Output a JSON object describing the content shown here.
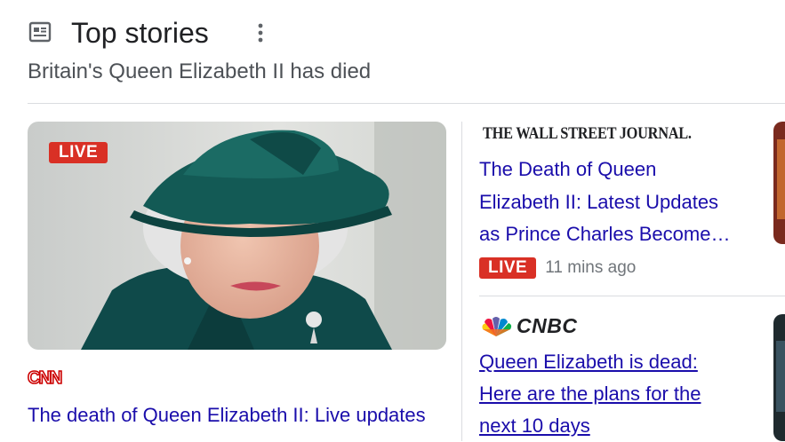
{
  "header": {
    "title": "Top stories",
    "subtitle": "Britain's Queen Elizabeth II has died",
    "icon": "newspaper-icon",
    "more_icon": "more-vert-icon"
  },
  "lead_story": {
    "badge": "LIVE",
    "source": "CNN",
    "title": "The death of Queen Elizabeth II: Live updates",
    "image": "queen-elizabeth-green-hat-photo"
  },
  "side_stories": [
    {
      "source": "THE WALL STREET JOURNAL.",
      "title_lines": [
        "The Death of Queen",
        "Elizabeth II: Latest Updates",
        "as Prince Charles Become…"
      ],
      "badge": "LIVE",
      "time": "11 mins ago"
    },
    {
      "source": "CNBC",
      "title_lines": [
        "Queen Elizabeth is dead:",
        "Here are the plans for the",
        "next 10 days"
      ]
    }
  ],
  "colors": {
    "link": "#1a0dab",
    "live_badge": "#d93025",
    "divider": "#dadce0",
    "muted": "#70757a"
  }
}
